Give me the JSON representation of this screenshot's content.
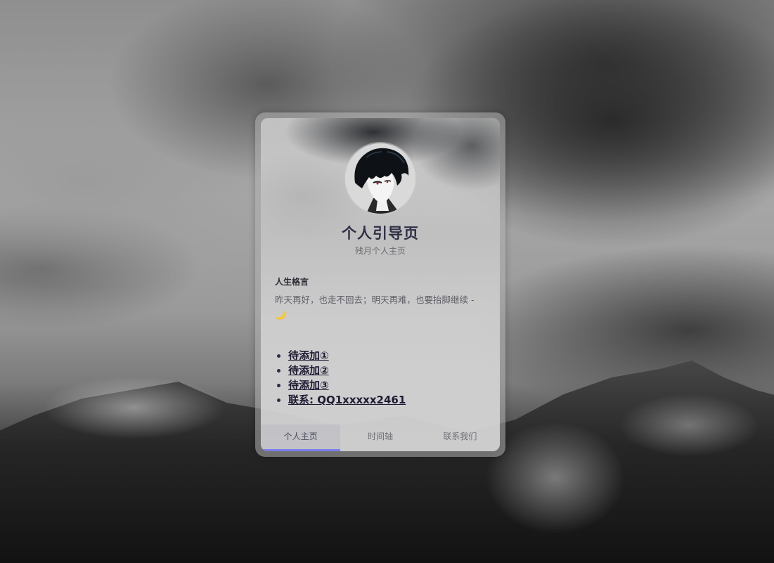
{
  "profile": {
    "title": "个人引导页",
    "subtitle": "残月个人主页",
    "avatar_icon": "anime-avatar"
  },
  "motto": {
    "heading": "人生格言",
    "text": "昨天再好，也走不回去；明天再难，也要抬脚继续 - 🌙"
  },
  "links": [
    {
      "label": "待添加①"
    },
    {
      "label": "待添加②"
    },
    {
      "label": "待添加③"
    },
    {
      "label": "联系: QQ1xxxxx2461"
    }
  ],
  "tabs": [
    {
      "label": "个人主页",
      "active": true
    },
    {
      "label": "时间轴",
      "active": false
    },
    {
      "label": "联系我们",
      "active": false
    }
  ],
  "colors": {
    "title": "#2f3047",
    "tab_accent": "#7b7ef0",
    "link": "#1f1b33"
  }
}
